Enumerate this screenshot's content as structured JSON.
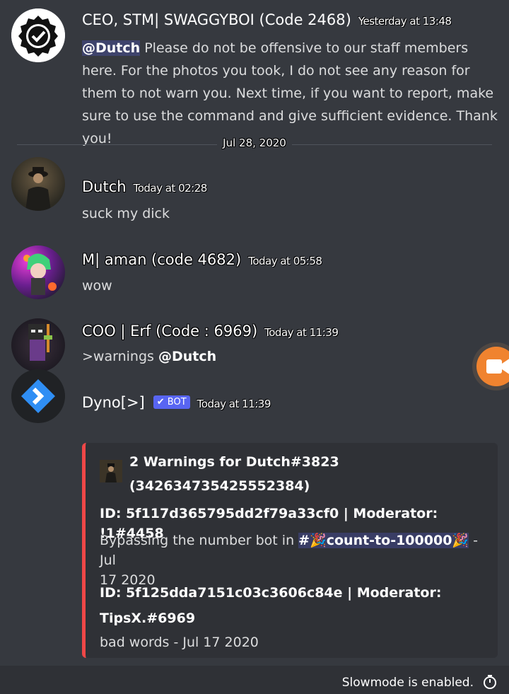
{
  "messages": [
    {
      "author": "CEO, STM| SWAGGYBOI (Code 2468)",
      "timestamp": "Yesterday at 13:48",
      "mention": "@Dutch",
      "text": " Please do not be offensive to our staff members here. For the photos you took, I do not see any reason for them to not warn you. Next time, if you want to report, make sure to use the command and give sufficient evidence. Thank you!"
    },
    {
      "author": "Dutch",
      "timestamp": "Today at 02:28",
      "text": "suck my dick"
    },
    {
      "author": "M| aman (code 4682)",
      "timestamp": "Today at 05:58",
      "text": "wow"
    },
    {
      "author": "COO | Erf (Code : 6969)",
      "timestamp": "Today at 11:39",
      "text_prefix": ">warnings ",
      "mention": "@Dutch"
    },
    {
      "author": "Dyno[>]",
      "badge": "BOT",
      "timestamp": "Today at 11:39"
    }
  ],
  "date_divider": "Jul 28, 2020",
  "embed": {
    "accent_color": "#f04747",
    "title_line1": "2 Warnings for Dutch#3823",
    "title_line2": "(342634735425552384)",
    "warnings": [
      {
        "header": "ID: 5f117d365795dd2f79a33cf0 | Moderator: !1#4458",
        "reason_prefix": "Bypassing the number bot in ",
        "channel": "#🎉count-to-100000🎉",
        "reason_suffix": " - Jul",
        "reason_line2": "17 2020"
      },
      {
        "header_line1": "ID: 5f125dda7151c03c3606c84e | Moderator:",
        "header_line2": "TipsX.#6969",
        "reason": "bad words - Jul 17 2020"
      }
    ]
  },
  "status_bar": {
    "slowmode_text": "Slowmode is enabled."
  },
  "colors": {
    "background": "#36393f",
    "embed_bg": "#2f3136",
    "brand": "#5865f2",
    "call_bubble": "#f0832f"
  }
}
